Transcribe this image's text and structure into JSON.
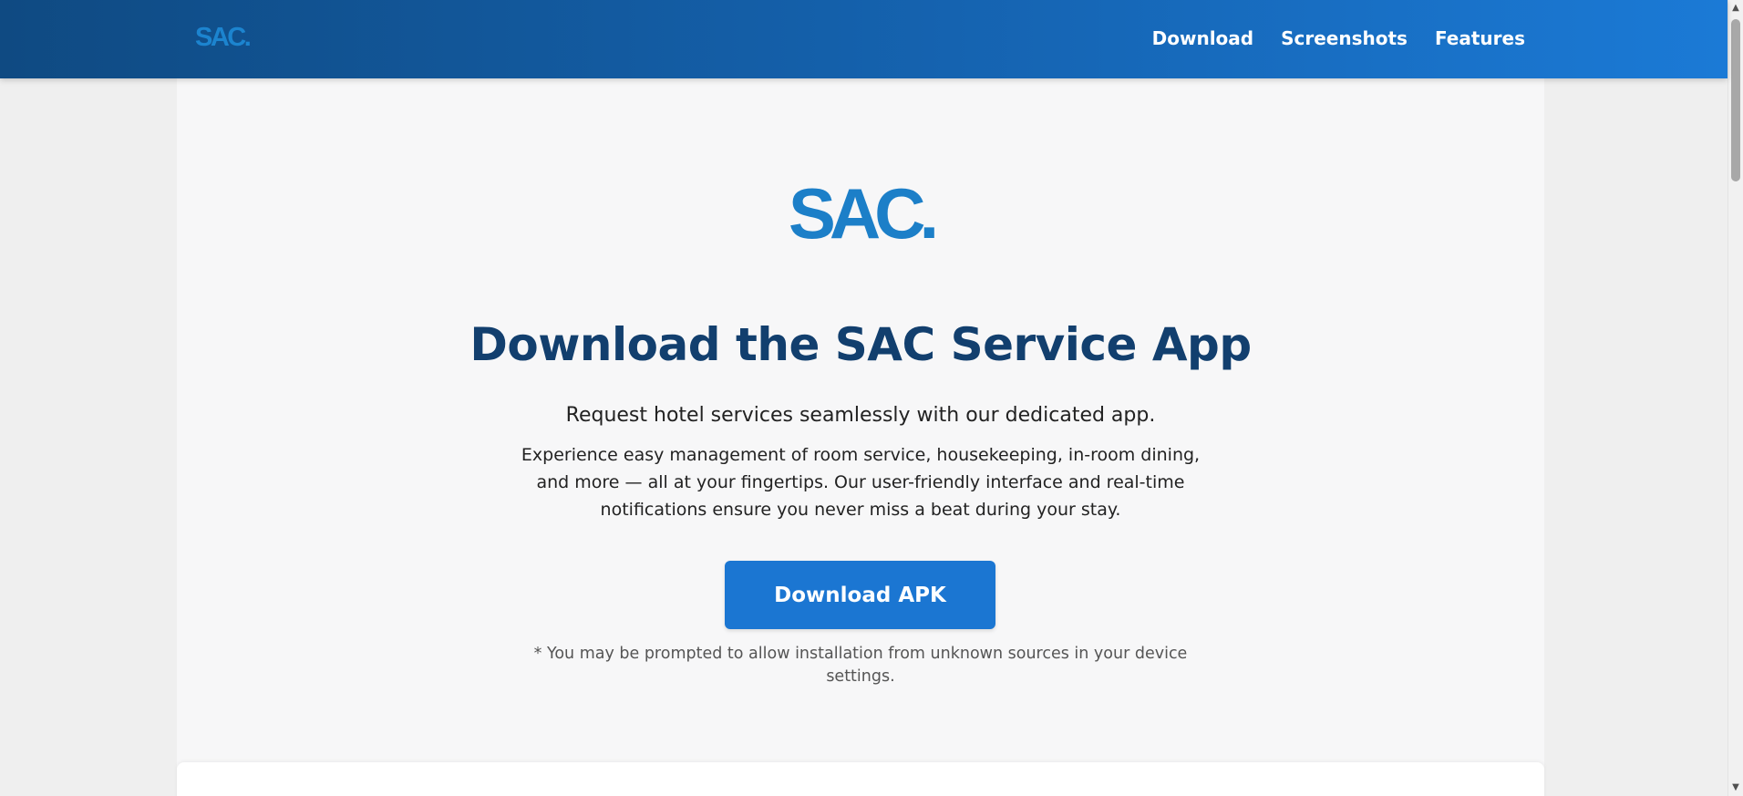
{
  "header": {
    "logo_text": "SAC.",
    "nav": [
      {
        "label": "Download"
      },
      {
        "label": "Screenshots"
      },
      {
        "label": "Features"
      }
    ]
  },
  "hero": {
    "logo_text": "SAC.",
    "title": "Download the SAC Service App",
    "subtitle": "Request hotel services seamlessly with our dedicated app.",
    "description": "Experience easy management of room service, housekeeping, in-room dining, and more — all at your fingertips. Our user-friendly interface and real-time notifications ensure you never miss a beat during your stay.",
    "button_label": "Download APK",
    "note": "* You may be prompted to allow installation from unknown sources in your device settings."
  },
  "scrollbar": {
    "up_icon": "triangle-up",
    "down_icon": "triangle-down"
  },
  "colors": {
    "brand_blue": "#1b76d2",
    "title_navy": "#123f6e",
    "header_start": "#0f4a82",
    "header_end": "#1b7ad6",
    "logo_blue": "#1c7fc8"
  }
}
